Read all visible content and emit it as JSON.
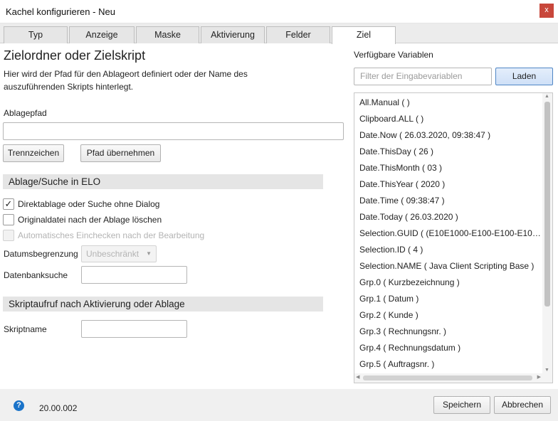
{
  "window": {
    "title": "Kachel konfigurieren - Neu",
    "close_glyph": "x"
  },
  "tabs": [
    "Typ",
    "Anzeige",
    "Maske",
    "Aktivierung",
    "Felder",
    "Ziel"
  ],
  "active_tab": "Ziel",
  "main": {
    "heading": "Zielordner oder Zielskript",
    "description": "Hier wird der Pfad für den Ablageort definiert oder der Name des auszuführenden Skripts hinterlegt.",
    "path_label": "Ablagepfad",
    "path_value": "",
    "separator_button": "Trennzeichen",
    "apply_path_button": "Pfad übernehmen",
    "section_storage": "Ablage/Suche in ELO",
    "checkbox_direct": {
      "label": "Direktablage oder Suche ohne Dialog",
      "checked": true,
      "glyph": "✓"
    },
    "checkbox_delete": {
      "label": "Originaldatei nach der Ablage löschen",
      "checked": false
    },
    "checkbox_checkin": {
      "label": "Automatisches Einchecken nach der Bearbeitung",
      "checked": false,
      "disabled": true
    },
    "date_limit_label": "Datumsbegrenzung",
    "date_limit_value": "Unbeschränkt",
    "db_search_label": "Datenbanksuche",
    "db_search_value": "",
    "section_script": "Skriptaufruf nach Aktivierung oder Ablage",
    "script_name_label": "Skriptname",
    "script_name_value": ""
  },
  "variables": {
    "label": "Verfügbare Variablen",
    "filter_placeholder": "Filter der Eingabevariablen",
    "load_button": "Laden",
    "items": [
      "All.Manual (  )",
      "Clipboard.ALL (  )",
      "Date.Now ( 26.03.2020, 09:38:47 )",
      "Date.ThisDay ( 26 )",
      "Date.ThisMonth ( 03 )",
      "Date.ThisYear ( 2020 )",
      "Date.Time ( 09:38:47 )",
      "Date.Today ( 26.03.2020 )",
      "Selection.GUID ( (E10E1000-E100-E100-E100-E1...",
      "Selection.ID ( 4 )",
      "Selection.NAME ( Java Client Scripting Base )",
      "Grp.0 ( Kurzbezeichnung )",
      "Grp.1 ( Datum )",
      "Grp.2 ( Kunde )",
      "Grp.3 ( Rechnungsnr. )",
      "Grp.4 ( Rechnungsdatum )",
      "Grp.5 ( Auftragsnr. )"
    ]
  },
  "footer": {
    "help_glyph": "?",
    "version": "20.00.002",
    "save_button": "Speichern",
    "cancel_button": "Abbrechen"
  },
  "colors": {
    "close_button": "#c8473b",
    "primary_button_border": "#4f86c5",
    "help_icon": "#1a73c9"
  }
}
